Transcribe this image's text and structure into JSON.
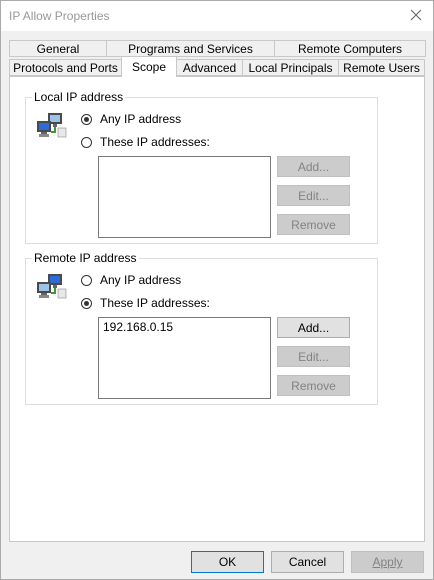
{
  "window": {
    "title": "IP Allow Properties"
  },
  "tabs": {
    "row1": [
      {
        "label": "General"
      },
      {
        "label": "Programs and Services"
      },
      {
        "label": "Remote Computers"
      }
    ],
    "row2": [
      {
        "label": "Protocols and Ports"
      },
      {
        "label": "Scope",
        "active": true
      },
      {
        "label": "Advanced"
      },
      {
        "label": "Local Principals"
      },
      {
        "label": "Remote Users"
      }
    ]
  },
  "local_group": {
    "label": "Local IP address",
    "any_label": "Any IP address",
    "these_label": "These IP addresses:",
    "selected": "any",
    "addresses": [],
    "buttons": {
      "add": "Add...",
      "edit": "Edit...",
      "remove": "Remove"
    }
  },
  "remote_group": {
    "label": "Remote IP address",
    "any_label": "Any IP address",
    "these_label": "These IP addresses:",
    "selected": "these",
    "addresses": [
      "192.168.0.15"
    ],
    "buttons": {
      "add": "Add...",
      "edit": "Edit...",
      "remove": "Remove"
    }
  },
  "footer": {
    "ok": "OK",
    "cancel": "Cancel",
    "apply": "Apply"
  },
  "icons": {
    "close": "close-icon",
    "network": "network-computers-icon"
  },
  "colors": {
    "accent": "#0078d7",
    "title_text": "#999999",
    "disabled_text": "#838383"
  }
}
